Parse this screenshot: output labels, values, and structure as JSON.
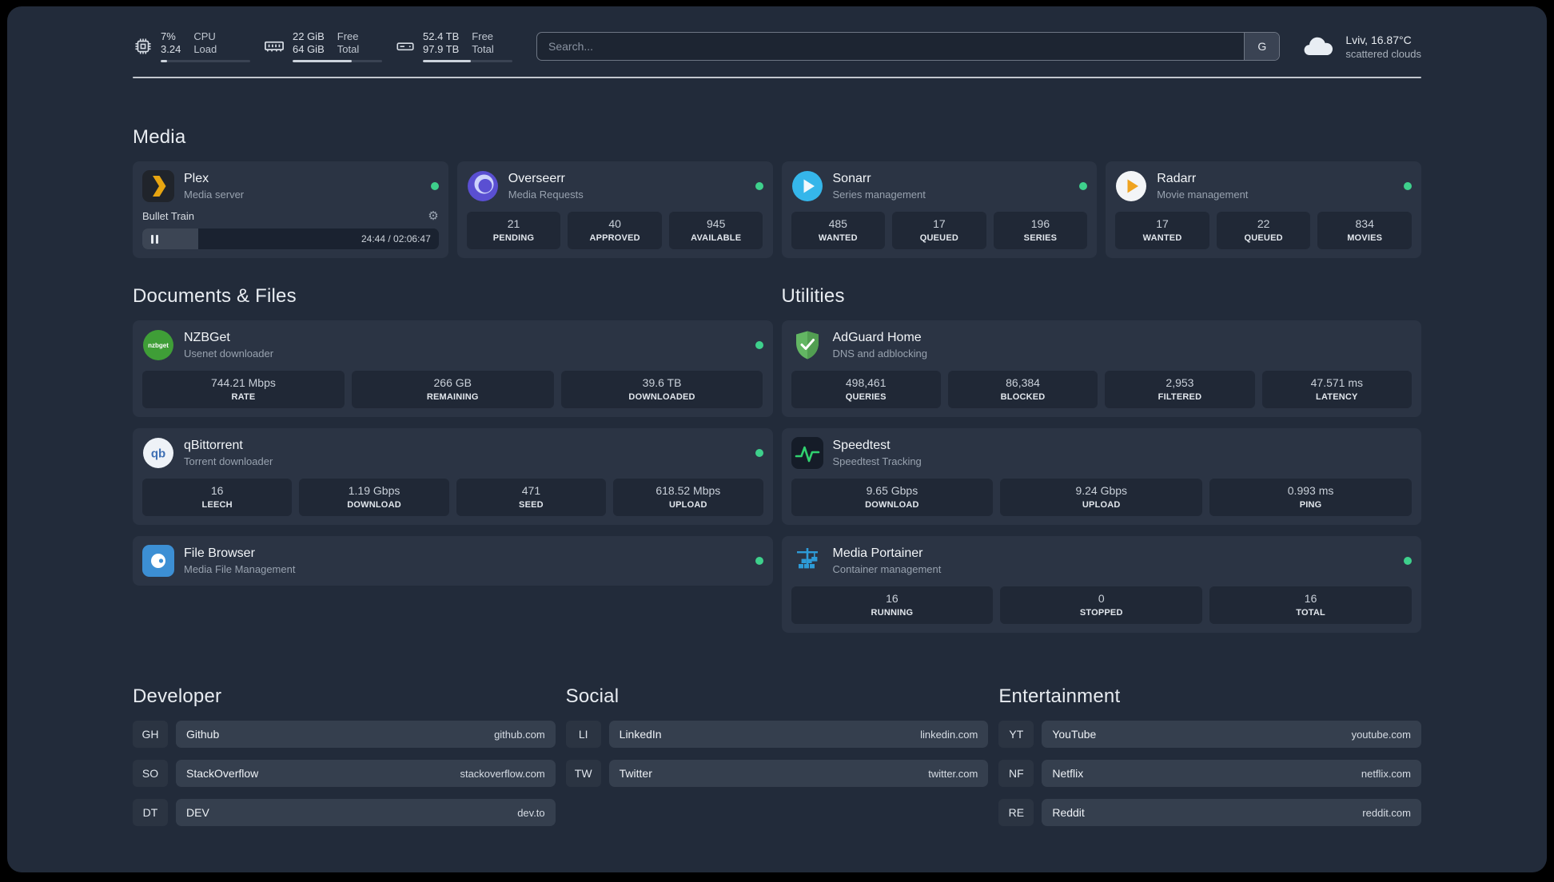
{
  "colors": {
    "panel_bg": "#222b3a",
    "card_bg": "#2b3444",
    "tile_bg": "#202836",
    "status_online": "#3ed08c",
    "plex_brand": "#e7a511",
    "adguard_green": "#63b663",
    "speedtest_green": "#30d16f",
    "portainer_blue": "#2d9bd8"
  },
  "topbar": {
    "resources": [
      {
        "icon": "cpu-icon",
        "values": [
          "7%",
          "3.24"
        ],
        "labels": [
          "CPU",
          "Load"
        ],
        "percent": 7
      },
      {
        "icon": "memory-icon",
        "values": [
          "22 GiB",
          "64 GiB"
        ],
        "labels": [
          "Free",
          "Total"
        ],
        "percent": 66
      },
      {
        "icon": "disk-icon",
        "values": [
          "52.4 TB",
          "97.9 TB"
        ],
        "labels": [
          "Free",
          "Total"
        ],
        "percent": 54
      }
    ],
    "search": {
      "placeholder": "Search...",
      "provider_label": "G"
    },
    "weather": {
      "icon": "cloud-icon",
      "location": "Lviv, 16.87°C",
      "condition": "scattered clouds"
    }
  },
  "sections": {
    "media": {
      "title": "Media",
      "services": [
        {
          "icon": "plex-icon",
          "name": "Plex",
          "subtitle": "Media server",
          "status": "online",
          "player": {
            "track": "Bullet Train",
            "time": "24:44 / 02:06:47",
            "progress_percent": 19
          }
        },
        {
          "icon": "overseerr-icon",
          "name": "Overseerr",
          "subtitle": "Media Requests",
          "status": "online",
          "stats": [
            {
              "value": "21",
              "label": "PENDING"
            },
            {
              "value": "40",
              "label": "APPROVED"
            },
            {
              "value": "945",
              "label": "AVAILABLE"
            }
          ]
        },
        {
          "icon": "sonarr-icon",
          "name": "Sonarr",
          "subtitle": "Series management",
          "status": "online",
          "stats": [
            {
              "value": "485",
              "label": "WANTED"
            },
            {
              "value": "17",
              "label": "QUEUED"
            },
            {
              "value": "196",
              "label": "SERIES"
            }
          ]
        },
        {
          "icon": "radarr-icon",
          "name": "Radarr",
          "subtitle": "Movie management",
          "status": "online",
          "stats": [
            {
              "value": "17",
              "label": "WANTED"
            },
            {
              "value": "22",
              "label": "QUEUED"
            },
            {
              "value": "834",
              "label": "MOVIES"
            }
          ]
        }
      ]
    },
    "documents": {
      "title": "Documents & Files",
      "services": [
        {
          "icon": "nzbget-icon",
          "name": "NZBGet",
          "subtitle": "Usenet downloader",
          "status": "online",
          "stats": [
            {
              "value": "744.21 Mbps",
              "label": "RATE"
            },
            {
              "value": "266 GB",
              "label": "REMAINING"
            },
            {
              "value": "39.6 TB",
              "label": "DOWNLOADED"
            }
          ]
        },
        {
          "icon": "qbittorrent-icon",
          "name": "qBittorrent",
          "subtitle": "Torrent downloader",
          "status": "online",
          "stats": [
            {
              "value": "16",
              "label": "LEECH"
            },
            {
              "value": "1.19 Gbps",
              "label": "DOWNLOAD"
            },
            {
              "value": "471",
              "label": "SEED"
            },
            {
              "value": "618.52 Mbps",
              "label": "UPLOAD"
            }
          ]
        },
        {
          "icon": "filebrowser-icon",
          "name": "File Browser",
          "subtitle": "Media File Management",
          "status": "online"
        }
      ]
    },
    "utilities": {
      "title": "Utilities",
      "services": [
        {
          "icon": "adguard-icon",
          "name": "AdGuard Home",
          "subtitle": "DNS and adblocking",
          "stats": [
            {
              "value": "498,461",
              "label": "QUERIES"
            },
            {
              "value": "86,384",
              "label": "BLOCKED"
            },
            {
              "value": "2,953",
              "label": "FILTERED"
            },
            {
              "value": "47.571 ms",
              "label": "LATENCY"
            }
          ]
        },
        {
          "icon": "speedtest-icon",
          "name": "Speedtest",
          "subtitle": "Speedtest Tracking",
          "stats": [
            {
              "value": "9.65 Gbps",
              "label": "DOWNLOAD"
            },
            {
              "value": "9.24 Gbps",
              "label": "UPLOAD"
            },
            {
              "value": "0.993 ms",
              "label": "PING"
            }
          ]
        },
        {
          "icon": "portainer-icon",
          "name": "Media Portainer",
          "subtitle": "Container management",
          "status": "online",
          "stats": [
            {
              "value": "16",
              "label": "RUNNING"
            },
            {
              "value": "0",
              "label": "STOPPED"
            },
            {
              "value": "16",
              "label": "TOTAL"
            }
          ]
        }
      ]
    }
  },
  "bookmarks": [
    {
      "title": "Developer",
      "items": [
        {
          "abbr": "GH",
          "name": "Github",
          "url": "github.com"
        },
        {
          "abbr": "SO",
          "name": "StackOverflow",
          "url": "stackoverflow.com"
        },
        {
          "abbr": "DT",
          "name": "DEV",
          "url": "dev.to"
        }
      ]
    },
    {
      "title": "Social",
      "items": [
        {
          "abbr": "LI",
          "name": "LinkedIn",
          "url": "linkedin.com"
        },
        {
          "abbr": "TW",
          "name": "Twitter",
          "url": "twitter.com"
        }
      ]
    },
    {
      "title": "Entertainment",
      "items": [
        {
          "abbr": "YT",
          "name": "YouTube",
          "url": "youtube.com"
        },
        {
          "abbr": "NF",
          "name": "Netflix",
          "url": "netflix.com"
        },
        {
          "abbr": "RE",
          "name": "Reddit",
          "url": "reddit.com"
        }
      ]
    }
  ]
}
